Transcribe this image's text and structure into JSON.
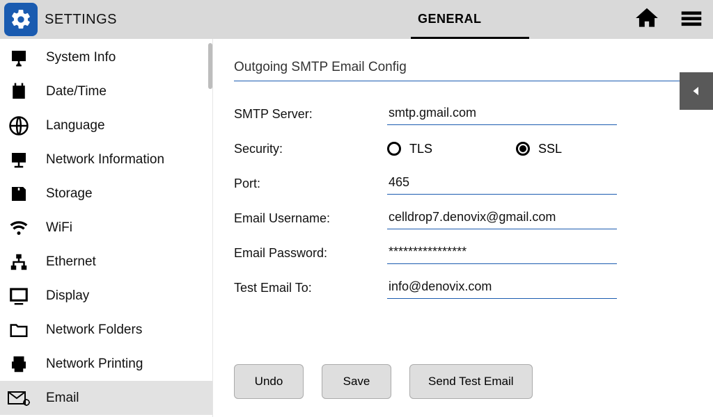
{
  "header": {
    "title": "SETTINGS",
    "tab": "GENERAL"
  },
  "sidebar": {
    "items": [
      {
        "label": "System Info"
      },
      {
        "label": "Date/Time"
      },
      {
        "label": "Language"
      },
      {
        "label": "Network Information"
      },
      {
        "label": "Storage"
      },
      {
        "label": "WiFi"
      },
      {
        "label": "Ethernet"
      },
      {
        "label": "Display"
      },
      {
        "label": "Network Folders"
      },
      {
        "label": "Network Printing"
      },
      {
        "label": "Email"
      }
    ],
    "active_index": 10
  },
  "panel": {
    "title": "Outgoing SMTP Email Config",
    "labels": {
      "smtp_server": "SMTP Server:",
      "security": "Security:",
      "port": "Port:",
      "email_username": "Email Username:",
      "email_password": "Email Password:",
      "test_email_to": "Test Email To:"
    },
    "values": {
      "smtp_server": "smtp.gmail.com",
      "port": "465",
      "email_username": "celldrop7.denovix@gmail.com",
      "email_password": "****************",
      "test_email_to": "info@denovix.com"
    },
    "security_options": {
      "tls": "TLS",
      "ssl": "SSL",
      "selected": "ssl"
    },
    "buttons": {
      "undo": "Undo",
      "save": "Save",
      "send_test": "Send Test Email"
    }
  }
}
